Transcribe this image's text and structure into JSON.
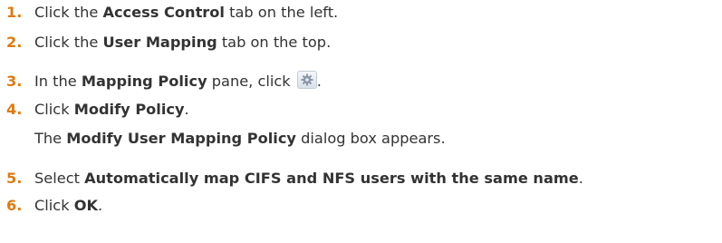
{
  "steps": [
    {
      "number": "1.",
      "parts": [
        "Click the ",
        "Access Control",
        " tab on the left."
      ]
    },
    {
      "number": "2.",
      "parts": [
        "Click the ",
        "User Mapping",
        " tab on the top."
      ]
    },
    {
      "number": "3.",
      "parts": [
        "In the ",
        "Mapping Policy",
        " pane, click ",
        "."
      ],
      "icon": "gear-icon"
    },
    {
      "number": "4.",
      "parts": [
        "Click ",
        "Modify Policy",
        "."
      ],
      "result": [
        "The ",
        "Modify User Mapping Policy",
        " dialog box appears."
      ]
    },
    {
      "number": "5.",
      "parts": [
        "Select ",
        "Automatically map CIFS and NFS users with the same name",
        "."
      ]
    },
    {
      "number": "6.",
      "parts": [
        "Click ",
        "OK",
        "."
      ]
    }
  ],
  "colors": {
    "step_number": "#e07a10",
    "text": "#333333"
  }
}
